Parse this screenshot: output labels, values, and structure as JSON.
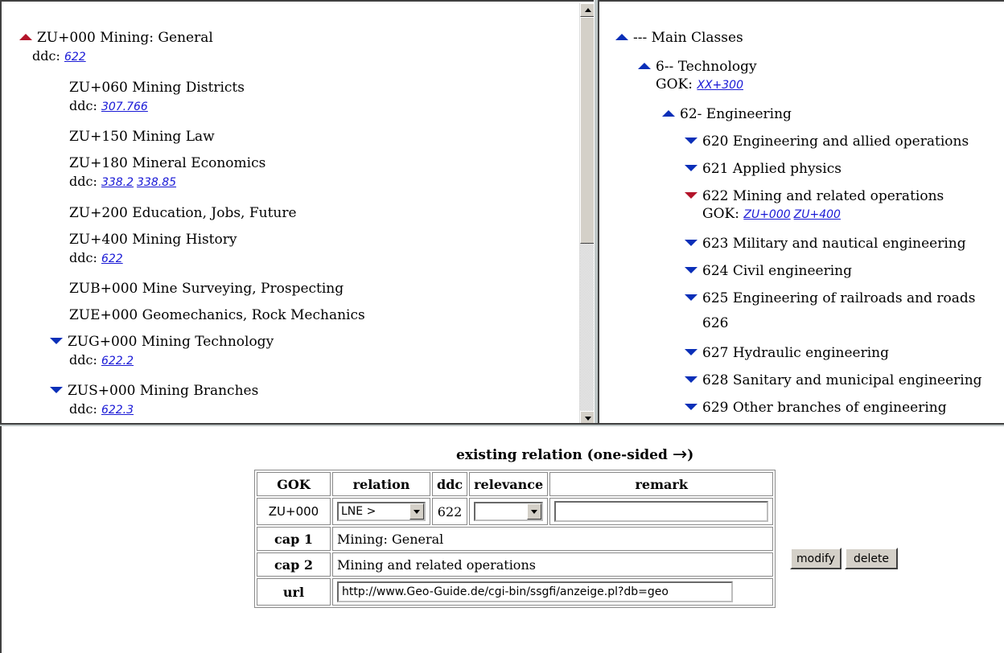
{
  "left_tree": {
    "root": {
      "label": "ZU+000 Mining: General",
      "ddc_label": "ddc:",
      "ddc_links": [
        "622"
      ]
    },
    "items": [
      {
        "label": "ZU+060 Mining Districts",
        "ddc_label": "ddc:",
        "ddc_links": [
          "307.766"
        ]
      },
      {
        "label": "ZU+150 Mining Law"
      },
      {
        "label": "ZU+180 Mineral Economics",
        "ddc_label": "ddc:",
        "ddc_links": [
          "338.2",
          "338.85"
        ]
      },
      {
        "label": "ZU+200 Education, Jobs, Future"
      },
      {
        "label": "ZU+400 Mining History",
        "ddc_label": "ddc:",
        "ddc_links": [
          "622"
        ]
      },
      {
        "label": "ZUB+000 Mine Surveying, Prospecting"
      },
      {
        "label": "ZUE+000 Geomechanics, Rock Mechanics"
      },
      {
        "label": "ZUG+000 Mining Technology",
        "ddc_label": "ddc:",
        "ddc_links": [
          "622.2"
        ]
      },
      {
        "label": "ZUS+000 Mining Branches",
        "ddc_label": "ddc:",
        "ddc_links": [
          "622.3"
        ]
      }
    ]
  },
  "right_tree": {
    "main": "--- Main Classes",
    "tech": {
      "label": "6-- Technology",
      "gok_label": "GOK:",
      "gok_links": [
        "XX+300"
      ]
    },
    "eng": "62- Engineering",
    "items": [
      {
        "label": "620 Engineering and allied operations"
      },
      {
        "label": "621 Applied physics"
      },
      {
        "label": "622 Mining and related operations",
        "gok_label": "GOK:",
        "gok_links": [
          "ZU+000",
          "ZU+400"
        ]
      },
      {
        "label": "623 Military and nautical engineering"
      },
      {
        "label": "624 Civil engineering"
      },
      {
        "label": "625 Engineering of railroads and roads"
      },
      {
        "label": "626"
      },
      {
        "label": "627 Hydraulic engineering"
      },
      {
        "label": "628 Sanitary and municipal engineering"
      },
      {
        "label": "629 Other branches of engineering"
      }
    ]
  },
  "relation": {
    "title": "existing relation (one-sided",
    "arrow": "→",
    "title_close": ")",
    "headers": {
      "gok": "GOK",
      "relation": "relation",
      "ddc": "ddc",
      "relevance": "relevance",
      "remark": "remark"
    },
    "row": {
      "gok": "ZU+000",
      "relation_value": "LNE >",
      "ddc": "622",
      "relevance_value": "",
      "remark_value": ""
    },
    "cap1_label": "cap 1",
    "cap1_value": "Mining: General",
    "cap2_label": "cap 2",
    "cap2_value": "Mining and related operations",
    "url_label": "url",
    "url_value": "http://www.Geo-Guide.de/cgi-bin/ssgfi/anzeige.pl?db=geo",
    "modify_label": "modify",
    "delete_label": "delete"
  },
  "colors": {
    "link": "#1a1ad6",
    "arrow_blue": "#0a2fb8",
    "arrow_red": "#b3142a"
  }
}
